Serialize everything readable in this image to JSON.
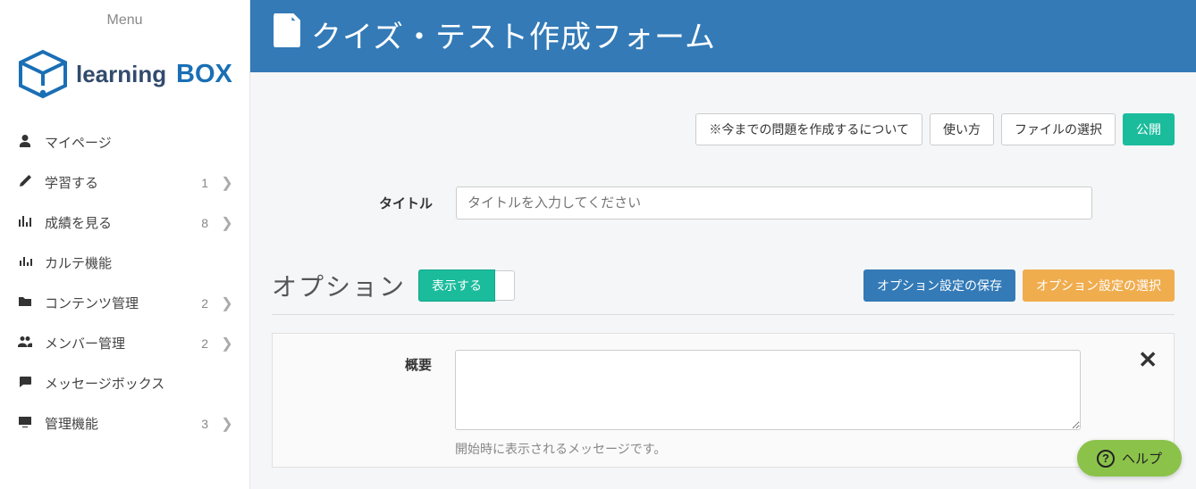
{
  "sidebar": {
    "menu_label": "Menu",
    "logo_text1": "learning",
    "logo_text2": "BOX",
    "items": [
      {
        "icon": "user",
        "label": "マイページ",
        "badge": "",
        "chevron": false
      },
      {
        "icon": "pencil",
        "label": "学習する",
        "badge": "1",
        "chevron": true
      },
      {
        "icon": "chart",
        "label": "成績を見る",
        "badge": "8",
        "chevron": true
      },
      {
        "icon": "stats",
        "label": "カルテ機能",
        "badge": "",
        "chevron": false
      },
      {
        "icon": "folder",
        "label": "コンテンツ管理",
        "badge": "2",
        "chevron": true
      },
      {
        "icon": "users",
        "label": "メンバー管理",
        "badge": "2",
        "chevron": true
      },
      {
        "icon": "chat",
        "label": "メッセージボックス",
        "badge": "",
        "chevron": false
      },
      {
        "icon": "monitor",
        "label": "管理機能",
        "badge": "3",
        "chevron": true
      }
    ]
  },
  "header": {
    "title": "クイズ・テスト作成フォーム"
  },
  "top_buttons": {
    "about": "※今までの問題を作成するについて",
    "howto": "使い方",
    "file": "ファイルの選択",
    "publish": "公開"
  },
  "title_field": {
    "label": "タイトル",
    "placeholder": "タイトルを入力してください"
  },
  "option": {
    "heading": "オプション",
    "toggle": "表示する",
    "save": "オプション設定の保存",
    "select": "オプション設定の選択"
  },
  "summary": {
    "label": "概要",
    "hint": "開始時に表示されるメッセージです。"
  },
  "help": {
    "label": "ヘルプ"
  }
}
